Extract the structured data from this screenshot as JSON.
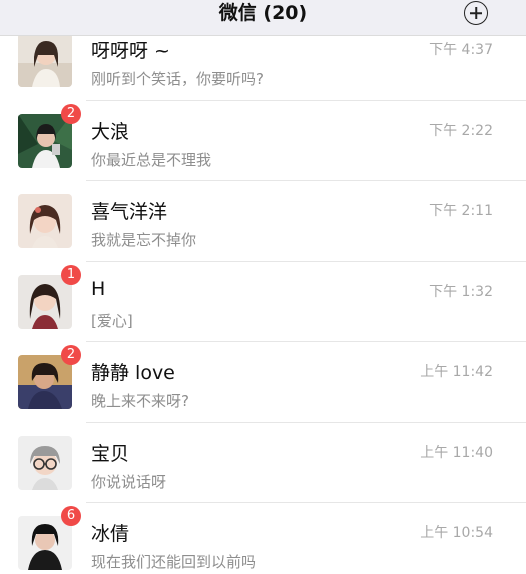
{
  "header": {
    "title": "微信 (20)",
    "add_icon": "plus-circle-icon"
  },
  "colors": {
    "badge": "#f04a48",
    "header_bg": "#efeff4",
    "muted_text": "#8e8e8e"
  },
  "chats": [
    {
      "name": "呀呀呀 ~",
      "preview": "刚听到个笑话，你要听吗?",
      "time": "下午 4:37",
      "badge": ""
    },
    {
      "name": "大浪",
      "preview": "你最近总是不理我",
      "time": "下午 2:22",
      "badge": "2"
    },
    {
      "name": "喜气洋洋",
      "preview": "我就是忘不掉你",
      "time": "下午 2:11",
      "badge": ""
    },
    {
      "name": "H",
      "preview": "[爱心]",
      "time": "下午 1:32",
      "badge": "1"
    },
    {
      "name": "静静 love",
      "preview": "晚上来不来呀?",
      "time": "上午 11:42",
      "badge": "2"
    },
    {
      "name": "宝贝",
      "preview": "你说说话呀",
      "time": "上午 11:40",
      "badge": ""
    },
    {
      "name": "冰倩",
      "preview": "现在我们还能回到以前吗",
      "time": "上午 10:54",
      "badge": "6"
    }
  ]
}
